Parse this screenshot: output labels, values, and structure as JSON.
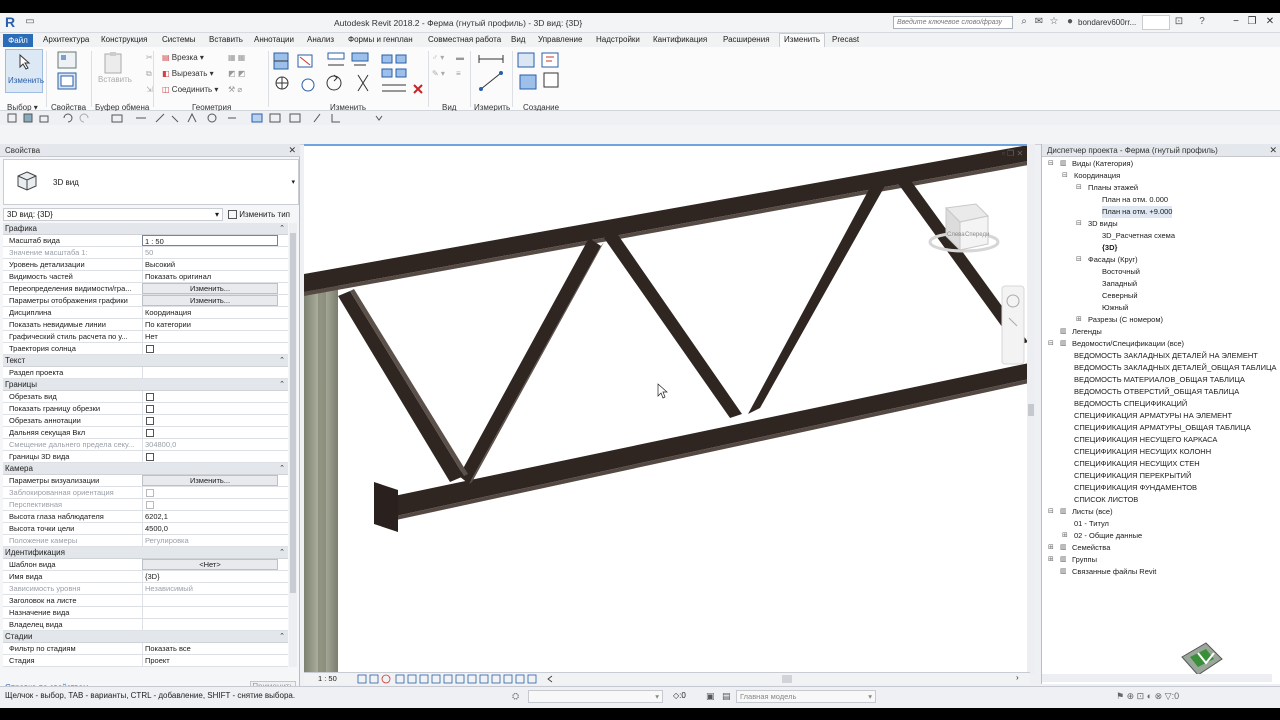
{
  "app": {
    "title": "Autodesk Revit 2018.2 -   Ферма (гнутый профиль) - 3D вид: {3D}",
    "search_placeholder": "Введите ключевое слово/фразу",
    "user": "bondarev600rr..."
  },
  "menu": {
    "file": "Файл",
    "items": [
      "Архитектура",
      "Конструкция",
      "Системы",
      "Вставить",
      "Аннотации",
      "Анализ",
      "Формы и генплан",
      "Совместная работа",
      "Вид",
      "Управление",
      "Надстройки",
      "Кантификация",
      "Расширения",
      "Изменить",
      "Precast"
    ]
  },
  "ribbon": {
    "modify_label": "Изменить",
    "paste_label": "Вставить",
    "cut_label": "Врезка",
    "cut2_label": "Вырезать",
    "join_label": "Соединить",
    "groups": [
      "Выбор",
      "Свойства",
      "Буфер обмена",
      "Геометрия",
      "Изменить",
      "Вид",
      "Измерить",
      "Создание"
    ]
  },
  "properties": {
    "panel_title": "Свойства",
    "type_name": "3D вид",
    "instance": "3D вид: {3D}",
    "edit_type": "Изменить тип",
    "sections": [
      {
        "name": "Графика",
        "rows": [
          {
            "k": "Масштаб вида",
            "v": "1 : 50",
            "kind": "input"
          },
          {
            "k": "Значение масштаба    1:",
            "v": "50",
            "kind": "text",
            "dis": true
          },
          {
            "k": "Уровень детализации",
            "v": "Высокий",
            "kind": "text"
          },
          {
            "k": "Видимость частей",
            "v": "Показать оригинал",
            "kind": "text"
          },
          {
            "k": "Переопределения видимости/гра...",
            "v": "Изменить...",
            "kind": "btn"
          },
          {
            "k": "Параметры отображения графики",
            "v": "Изменить...",
            "kind": "btn"
          },
          {
            "k": "Дисциплина",
            "v": "Координация",
            "kind": "text"
          },
          {
            "k": "Показать невидимые линии",
            "v": "По категории",
            "kind": "text"
          },
          {
            "k": "Графический стиль расчета по у...",
            "v": "Нет",
            "kind": "text"
          },
          {
            "k": "Траектория солнца",
            "v": "",
            "kind": "chk"
          }
        ]
      },
      {
        "name": "Текст",
        "rows": [
          {
            "k": "Раздел проекта",
            "v": "",
            "kind": "text"
          }
        ]
      },
      {
        "name": "Границы",
        "rows": [
          {
            "k": "Обрезать вид",
            "v": "",
            "kind": "chk"
          },
          {
            "k": "Показать границу обрезки",
            "v": "",
            "kind": "chk"
          },
          {
            "k": "Обрезать аннотации",
            "v": "",
            "kind": "chk"
          },
          {
            "k": "Дальняя секущая Вкл",
            "v": "",
            "kind": "chk"
          },
          {
            "k": "Смещение дальнего предела секу...",
            "v": "304800,0",
            "kind": "text",
            "dis": true
          },
          {
            "k": "Границы 3D вида",
            "v": "",
            "kind": "chk"
          }
        ]
      },
      {
        "name": "Камера",
        "rows": [
          {
            "k": "Параметры визуализации",
            "v": "Изменить...",
            "kind": "btn"
          },
          {
            "k": "Заблокированная ориентация",
            "v": "",
            "kind": "chkdis",
            "dis": true
          },
          {
            "k": "Перспективная",
            "v": "",
            "kind": "chkdis",
            "dis": true
          },
          {
            "k": "Высота глаза наблюдателя",
            "v": "6202,1",
            "kind": "text"
          },
          {
            "k": "Высота точки цели",
            "v": "4500,0",
            "kind": "text"
          },
          {
            "k": "Положение камеры",
            "v": "Регулировка",
            "kind": "text",
            "dis": true
          }
        ]
      },
      {
        "name": "Идентификация",
        "rows": [
          {
            "k": "Шаблон вида",
            "v": "<Нет>",
            "kind": "btn"
          },
          {
            "k": "Имя вида",
            "v": "{3D}",
            "kind": "text"
          },
          {
            "k": "Зависимость уровня",
            "v": "Независимый",
            "kind": "text",
            "dis": true
          },
          {
            "k": "Заголовок на листе",
            "v": "",
            "kind": "text"
          },
          {
            "k": "Назначение вида",
            "v": "",
            "kind": "text"
          },
          {
            "k": "Владелец вида",
            "v": "",
            "kind": "text"
          }
        ]
      },
      {
        "name": "Стадии",
        "rows": [
          {
            "k": "Фильтр по стадиям",
            "v": "Показать все",
            "kind": "text"
          },
          {
            "k": "Стадия",
            "v": "Проект",
            "kind": "text"
          }
        ]
      }
    ],
    "help_link": "Справка по свойствам",
    "apply": "Применить"
  },
  "viewport": {
    "scale": "1 : 50",
    "viewcube_left": "Слева",
    "viewcube_front": "Спереди"
  },
  "browser": {
    "panel_title": "Диспетчер проекта - Ферма (гнутый профиль)",
    "items": [
      {
        "label": "Виды (Категория)",
        "level": 0,
        "tw": "−",
        "icon": true
      },
      {
        "label": "Координация",
        "level": 1,
        "tw": "−"
      },
      {
        "label": "Планы этажей",
        "level": 2,
        "tw": "−"
      },
      {
        "label": "План на отм. 0.000",
        "level": 3
      },
      {
        "label": "План на отм. +9.000",
        "level": 3,
        "sel": true
      },
      {
        "label": "3D виды",
        "level": 2,
        "tw": "−"
      },
      {
        "label": "3D_Расчетная схема",
        "level": 3
      },
      {
        "label": "{3D}",
        "level": 3,
        "bold": true
      },
      {
        "label": "Фасады (Круг)",
        "level": 2,
        "tw": "−"
      },
      {
        "label": "Восточный",
        "level": 3
      },
      {
        "label": "Западный",
        "level": 3
      },
      {
        "label": "Северный",
        "level": 3
      },
      {
        "label": "Южный",
        "level": 3
      },
      {
        "label": "Разрезы (С номером)",
        "level": 2,
        "tw": "+"
      },
      {
        "label": "Легенды",
        "level": 0,
        "icon": true
      },
      {
        "label": "Ведомости/Спецификации (все)",
        "level": 0,
        "tw": "−",
        "icon": true
      },
      {
        "label": "ВЕДОМОСТЬ ЗАКЛАДНЫХ ДЕТАЛЕЙ НА ЭЛЕМЕНТ",
        "level": 1
      },
      {
        "label": "ВЕДОМОСТЬ ЗАКЛАДНЫХ ДЕТАЛЕЙ_ОБЩАЯ ТАБЛИЦА",
        "level": 1
      },
      {
        "label": "ВЕДОМОСТЬ МАТЕРИАЛОВ_ОБЩАЯ ТАБЛИЦА",
        "level": 1
      },
      {
        "label": "ВЕДОМОСТЬ ОТВЕРСТИЙ_ОБЩАЯ ТАБЛИЦА",
        "level": 1
      },
      {
        "label": "ВЕДОМОСТЬ СПЕЦИФИКАЦИЙ",
        "level": 1
      },
      {
        "label": "СПЕЦИФИКАЦИЯ АРМАТУРЫ НА ЭЛЕМЕНТ",
        "level": 1
      },
      {
        "label": "СПЕЦИФИКАЦИЯ АРМАТУРЫ_ОБЩАЯ ТАБЛИЦА",
        "level": 1
      },
      {
        "label": "СПЕЦИФИКАЦИЯ НЕСУЩЕГО КАРКАСА",
        "level": 1
      },
      {
        "label": "СПЕЦИФИКАЦИЯ НЕСУЩИХ КОЛОНН",
        "level": 1
      },
      {
        "label": "СПЕЦИФИКАЦИЯ НЕСУЩИХ СТЕН",
        "level": 1
      },
      {
        "label": "СПЕЦИФИКАЦИЯ ПЕРЕКРЫТИЙ",
        "level": 1
      },
      {
        "label": "СПЕЦИФИКАЦИЯ ФУНДАМЕНТОВ",
        "level": 1
      },
      {
        "label": "СПИСОК ЛИСТОВ",
        "level": 1
      },
      {
        "label": "Листы (все)",
        "level": 0,
        "tw": "−",
        "icon": true
      },
      {
        "label": "01 - Титул",
        "level": 1
      },
      {
        "label": "02 - Общие данные",
        "level": 1,
        "tw": "+"
      },
      {
        "label": "Семейства",
        "level": 0,
        "tw": "+",
        "icon": true
      },
      {
        "label": "Группы",
        "level": 0,
        "tw": "+",
        "icon": true
      },
      {
        "label": "Связанные файлы Revit",
        "level": 0,
        "icon": true
      }
    ]
  },
  "status": {
    "message": "Щелчок - выбор, TAB - варианты, CTRL - добавление, SHIFT - снятие выбора.",
    "zero": ":0",
    "model": "Главная модель",
    "filter_count": ":0"
  },
  "colors": {
    "accent": "#2a6cb8",
    "truss": "#2f2622",
    "column": "#9a9d8c",
    "viewport_border": "#6ea4df"
  }
}
